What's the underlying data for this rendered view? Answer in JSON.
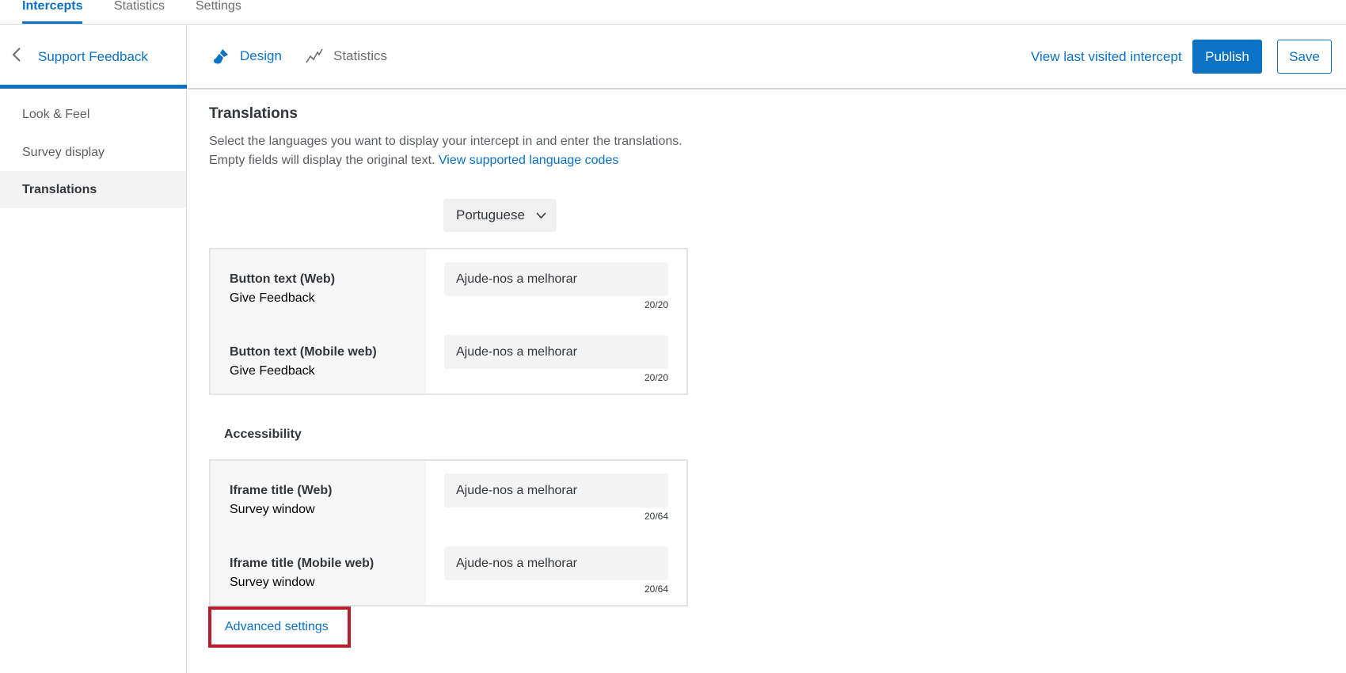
{
  "top_tabs": [
    {
      "label": "Intercepts",
      "active": true
    },
    {
      "label": "Statistics",
      "active": false
    },
    {
      "label": "Settings",
      "active": false
    }
  ],
  "sidebar": {
    "back_label": "Support Feedback",
    "items": [
      {
        "label": "Look & Feel",
        "active": false
      },
      {
        "label": "Survey display",
        "active": false
      },
      {
        "label": "Translations",
        "active": true
      }
    ]
  },
  "header": {
    "tabs": [
      {
        "label": "Design",
        "icon": "paintbrush-icon",
        "active": true
      },
      {
        "label": "Statistics",
        "icon": "line-chart-icon",
        "active": false
      }
    ],
    "view_link": "View last visited intercept",
    "publish_label": "Publish",
    "save_label": "Save"
  },
  "main": {
    "title": "Translations",
    "description": "Select the languages you want to display your intercept in and enter the translations. Empty fields will display the original text.",
    "description_link": "View supported language codes",
    "language_select": "Portuguese",
    "button_rows": [
      {
        "title": "Button text (Web)",
        "original": "Give Feedback",
        "value": "Ajude-nos a melhorar",
        "count": "20/20"
      },
      {
        "title": "Button text (Mobile web)",
        "original": "Give Feedback",
        "value": "Ajude-nos a melhorar",
        "count": "20/20"
      }
    ],
    "accessibility_title": "Accessibility",
    "accessibility_rows": [
      {
        "title": "Iframe title (Web)",
        "original": "Survey window",
        "value": "Ajude-nos a melhorar",
        "count": "20/64"
      },
      {
        "title": "Iframe title (Mobile web)",
        "original": "Survey window",
        "value": "Ajude-nos a melhorar",
        "count": "20/64"
      }
    ],
    "advanced_settings": "Advanced settings"
  },
  "colors": {
    "accent": "#0b72c4",
    "highlight_border": "#b51f2e"
  }
}
